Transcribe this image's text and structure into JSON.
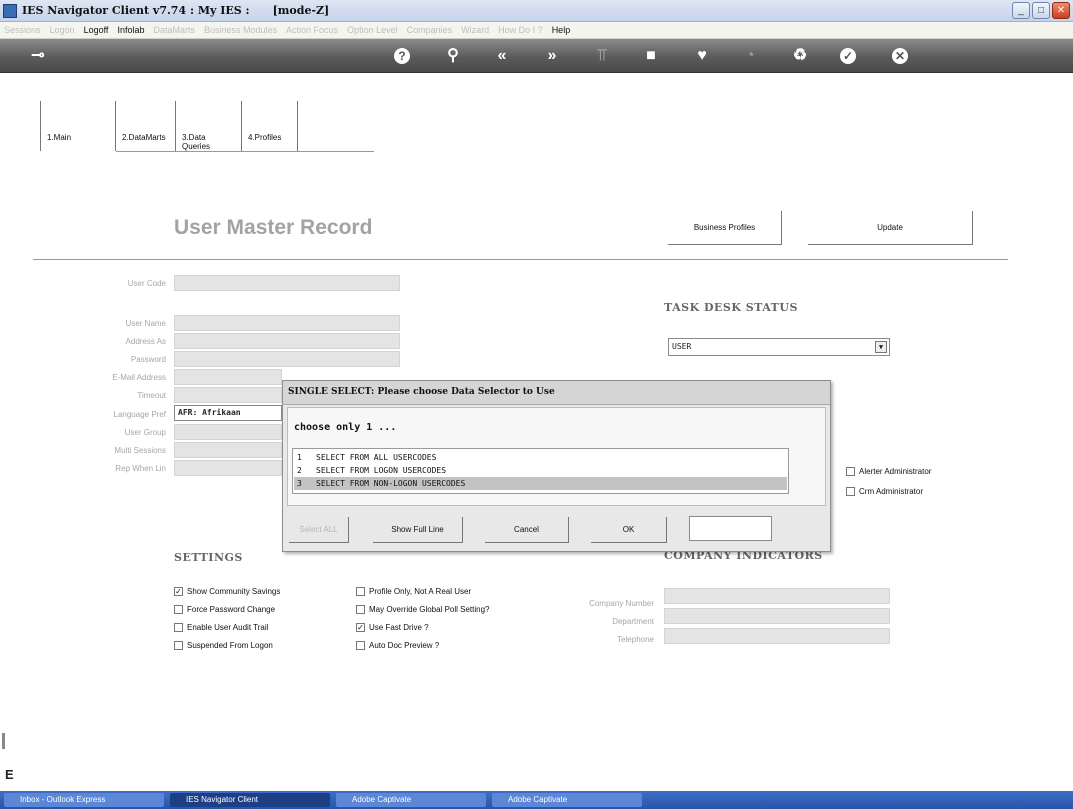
{
  "window": {
    "title": "IES Navigator Client v7.74 : My IES :      [mode-Z]"
  },
  "menu": {
    "items": [
      "Sessions",
      "Logon",
      "Logoff",
      "Infolab",
      "DataMarts",
      "Business Modules",
      "Action Focus",
      "Option Level",
      "Companies",
      "Wizard",
      "How Do I ?",
      "Help"
    ]
  },
  "tabs": [
    "1.Main",
    "2.DataMarts",
    "3.Data Queries",
    "4.Profiles"
  ],
  "page": {
    "title": "User Master Record",
    "business_profiles_btn": "Business Profiles",
    "update_btn": "Update"
  },
  "fields": {
    "user_code": "User Code",
    "user_name": "User Name",
    "address_as": "Address As",
    "password": "Password",
    "email": "E-Mail Address",
    "timeout": "Timeout",
    "language_pref": "Language Pref",
    "language_value": "AFR: Afrikaan",
    "user_group": "User Group",
    "multi_sessions": "Multi Sessions",
    "rep_when_lin": "Rep When Lin"
  },
  "task_desk": {
    "heading": "TASK DESK STATUS",
    "value": "USER"
  },
  "admin_checks": {
    "alerter": "Alerter Administrator",
    "crm": "Crm Administrator"
  },
  "settings": {
    "heading": "SETTINGS",
    "items": [
      {
        "label": "Show Community Savings",
        "checked": true
      },
      {
        "label": "Force Password Change",
        "checked": false
      },
      {
        "label": "Enable User Audit Trail",
        "checked": false
      },
      {
        "label": "Suspended From Logon",
        "checked": false
      },
      {
        "label": "Profile Only, Not A Real User",
        "checked": false
      },
      {
        "label": "May Override Global Poll Setting?",
        "checked": false
      },
      {
        "label": "Use Fast Drive ?",
        "checked": true
      },
      {
        "label": "Auto Doc Preview ?",
        "checked": false
      }
    ]
  },
  "company": {
    "heading": "COMPANY INDICATORS",
    "company_number": "Company Number",
    "department": "Department",
    "telephone": "Telephone"
  },
  "dialog": {
    "title": "SINGLE SELECT: Please choose Data Selector to Use",
    "prompt": "choose only 1 ...",
    "options": [
      {
        "num": "1",
        "label": "SELECT FROM ALL USERCODES"
      },
      {
        "num": "2",
        "label": "SELECT FROM LOGON USERCODES"
      },
      {
        "num": "3",
        "label": "SELECT FROM NON-LOGON USERCODES"
      }
    ],
    "selected_index": 2,
    "buttons": {
      "select_all": "Select ALL",
      "show_full_line": "Show Full Line",
      "cancel": "Cancel",
      "ok": "OK"
    }
  },
  "taskbar": {
    "items": [
      "Inbox - Outlook Express",
      "IES Navigator Client",
      "Adobe Captivate",
      "Adobe Captivate"
    ]
  },
  "status_letter": "E"
}
